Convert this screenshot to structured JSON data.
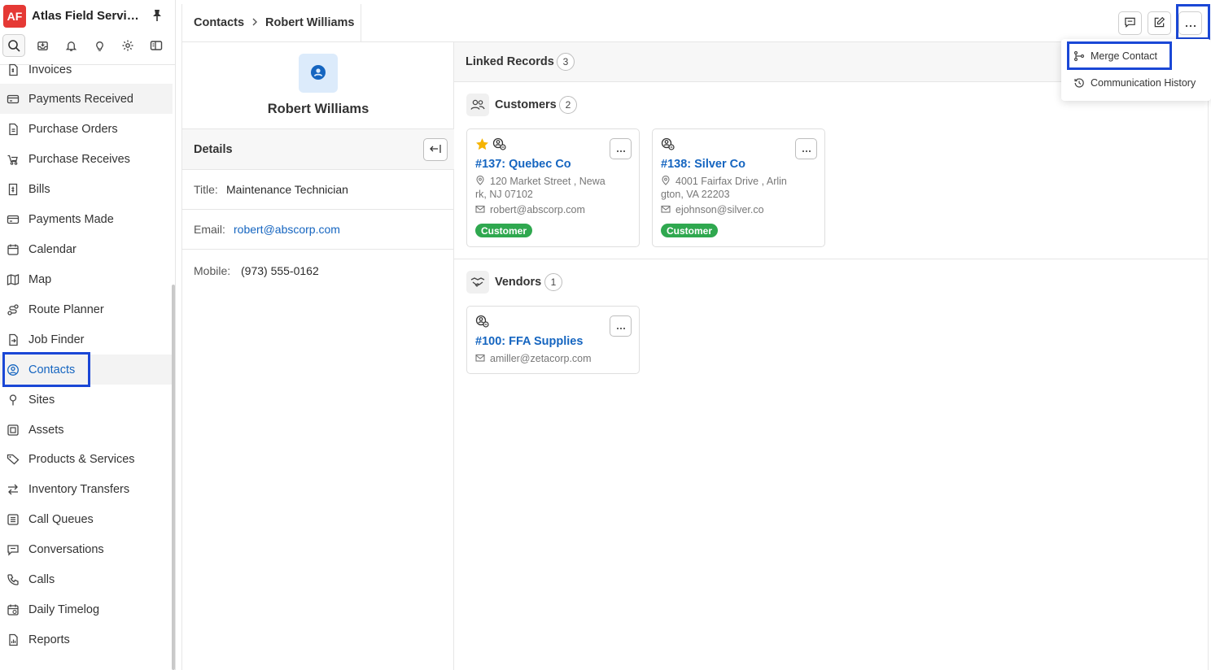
{
  "app": {
    "logo_text": "AF",
    "name": "Atlas Field Servic..."
  },
  "toolbar": {
    "icons": [
      "search-icon",
      "inbox-icon",
      "bell-icon",
      "lightbulb-icon",
      "gear-icon",
      "panel-icon"
    ]
  },
  "sidebar": {
    "items": [
      {
        "label": "Invoices",
        "icon": "invoice-icon"
      },
      {
        "label": "Payments Received",
        "icon": "card-icon"
      },
      {
        "label": "Purchase Orders",
        "icon": "document-icon"
      },
      {
        "label": "Purchase Receives",
        "icon": "truck-icon"
      },
      {
        "label": "Bills",
        "icon": "bill-icon"
      },
      {
        "label": "Payments Made",
        "icon": "card-icon"
      },
      {
        "label": "Calendar",
        "icon": "calendar-icon"
      },
      {
        "label": "Map",
        "icon": "map-icon"
      },
      {
        "label": "Route Planner",
        "icon": "route-icon"
      },
      {
        "label": "Job Finder",
        "icon": "job-finder-icon"
      },
      {
        "label": "Contacts",
        "icon": "user-circle-icon"
      },
      {
        "label": "Sites",
        "icon": "pin-icon"
      },
      {
        "label": "Assets",
        "icon": "asset-icon"
      },
      {
        "label": "Products & Services",
        "icon": "tag-icon"
      },
      {
        "label": "Inventory Transfers",
        "icon": "transfer-icon"
      },
      {
        "label": "Call Queues",
        "icon": "queue-icon"
      },
      {
        "label": "Conversations",
        "icon": "chat-icon"
      },
      {
        "label": "Calls",
        "icon": "phone-icon"
      },
      {
        "label": "Daily Timelog",
        "icon": "timelog-icon"
      },
      {
        "label": "Reports",
        "icon": "report-icon"
      }
    ]
  },
  "breadcrumb": {
    "root": "Contacts",
    "current": "Robert Williams"
  },
  "contact": {
    "name": "Robert Williams",
    "details_title": "Details",
    "title_label": "Title:",
    "title_value": "Maintenance Technician",
    "email_label": "Email:",
    "email_value": "robert@abscorp.com",
    "mobile_label": "Mobile:",
    "mobile_value": "(973) 555-0162"
  },
  "linked": {
    "title": "Linked Records",
    "count": "3",
    "customers": {
      "title": "Customers",
      "count": "2",
      "cards": [
        {
          "name": "#137: Quebec Co",
          "address": "120 Market Street , Newark, NJ 07102",
          "email": "robert@abscorp.com",
          "badge": "Customer"
        },
        {
          "name": "#138: Silver Co",
          "address": "4001 Fairfax Drive , Arlington, VA 22203",
          "email": "ejohnson@silver.co",
          "badge": "Customer"
        }
      ]
    },
    "vendors": {
      "title": "Vendors",
      "count": "1",
      "cards": [
        {
          "name": "#100: FFA Supplies",
          "email": "amiller@zetacorp.com"
        }
      ]
    }
  },
  "menu": {
    "items": [
      {
        "label": "Merge Contact",
        "icon": "merge-icon"
      },
      {
        "label": "Communication History",
        "icon": "history-icon"
      }
    ]
  },
  "colors": {
    "accent": "#1565c0",
    "highlight_box": "#1a47d6",
    "badge_green": "#2fa84f",
    "logo_red": "#e53935",
    "star": "#f5b301"
  }
}
